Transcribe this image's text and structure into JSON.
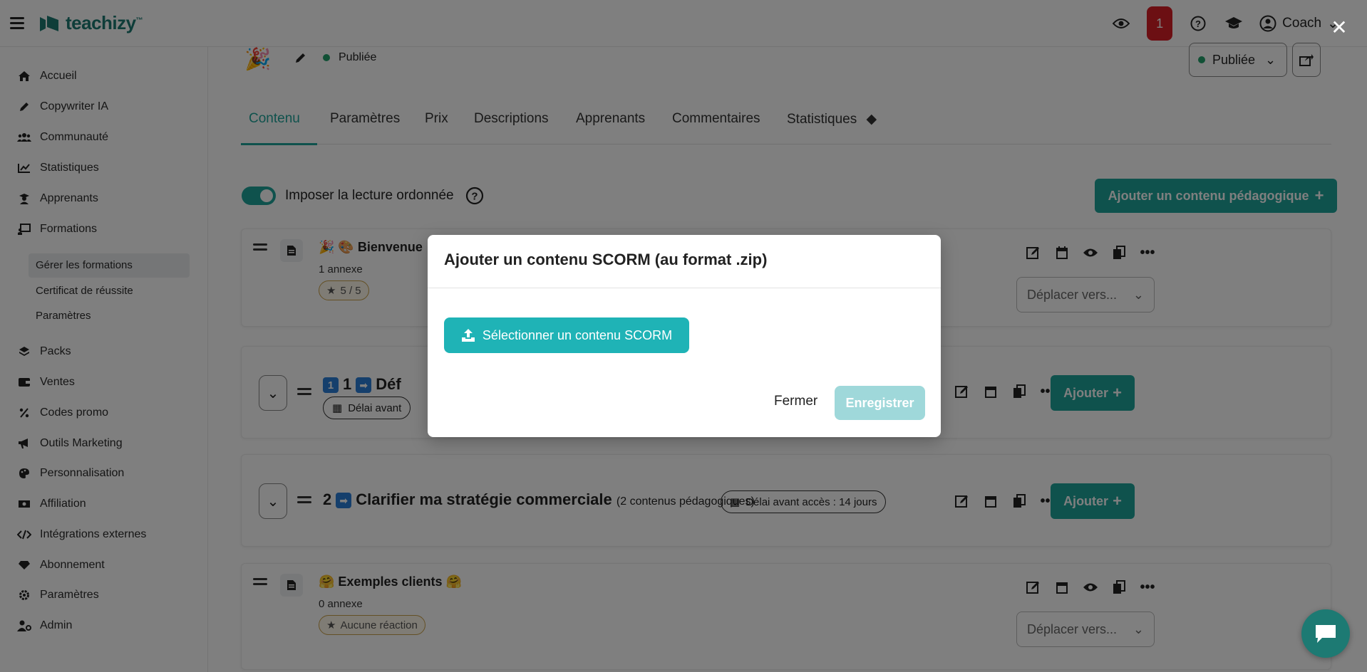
{
  "brand": {
    "name": "teachizy",
    "mark": "™",
    "color": "#1d7a73"
  },
  "topbar": {
    "notification_count": "1",
    "user_label": "Coach"
  },
  "sidebar": {
    "items": [
      {
        "label": "Accueil",
        "icon": "home-icon"
      },
      {
        "label": "Copywriter IA",
        "icon": "pen-icon"
      },
      {
        "label": "Communauté",
        "icon": "users-icon"
      },
      {
        "label": "Statistiques",
        "icon": "chart-icon"
      },
      {
        "label": "Apprenants",
        "icon": "student-icon"
      },
      {
        "label": "Formations",
        "icon": "chalkboard-icon"
      },
      {
        "label": "Packs",
        "icon": "layers-icon"
      },
      {
        "label": "Ventes",
        "icon": "wallet-icon"
      },
      {
        "label": "Codes promo",
        "icon": "percent-icon"
      },
      {
        "label": "Outils Marketing",
        "icon": "megaphone-icon"
      },
      {
        "label": "Personnalisation",
        "icon": "palette-icon"
      },
      {
        "label": "Affiliation",
        "icon": "money-icon"
      },
      {
        "label": "Intégrations externes",
        "icon": "code-icon"
      },
      {
        "label": "Abonnement",
        "icon": "diamond-icon"
      },
      {
        "label": "Paramètres",
        "icon": "gear-icon"
      },
      {
        "label": "Admin",
        "icon": "user-gear-icon"
      }
    ],
    "formations_sub": [
      "Gérer les formations",
      "Certificat de réussite",
      "Paramètres"
    ]
  },
  "course": {
    "status": "Publiée",
    "status_select": "Publiée"
  },
  "tabs": [
    "Contenu",
    "Paramètres",
    "Prix",
    "Descriptions",
    "Apprenants",
    "Commentaires",
    "Statistiques"
  ],
  "ordered_reading_label": "Imposer la lecture ordonnée",
  "add_content_label": "Ajouter un contenu pédagogique",
  "cards": {
    "welcome": {
      "title": "🎉 🎨 Bienvenue",
      "annex": "1 annexe",
      "rating": "5 / 5",
      "move_placeholder": "Déplacer vers..."
    },
    "section1": {
      "num": "1",
      "title": "1",
      "title_cut": "Déf",
      "delay_label": "Délai avant",
      "add_label": "Ajouter"
    },
    "section2": {
      "num": "2",
      "title": "Clarifier ma stratégie commerciale",
      "count": "(2 contenus pédagogiques)",
      "delay_label": "Délai avant accès : 14 jours",
      "add_label": "Ajouter"
    },
    "examples": {
      "title": "🤗 Exemples clients 🤗",
      "annex": "0 annexe",
      "reaction": "Aucune réaction",
      "move_placeholder": "Déplacer vers..."
    }
  },
  "modal": {
    "title": "Ajouter un contenu SCORM (au format .zip)",
    "upload_label": "Sélectionner un contenu SCORM",
    "close_label": "Fermer",
    "save_label": "Enregistrer"
  },
  "colors": {
    "accent": "#1fa49a",
    "upload": "#1fb3b6",
    "save_disabled": "#9fd8da"
  }
}
